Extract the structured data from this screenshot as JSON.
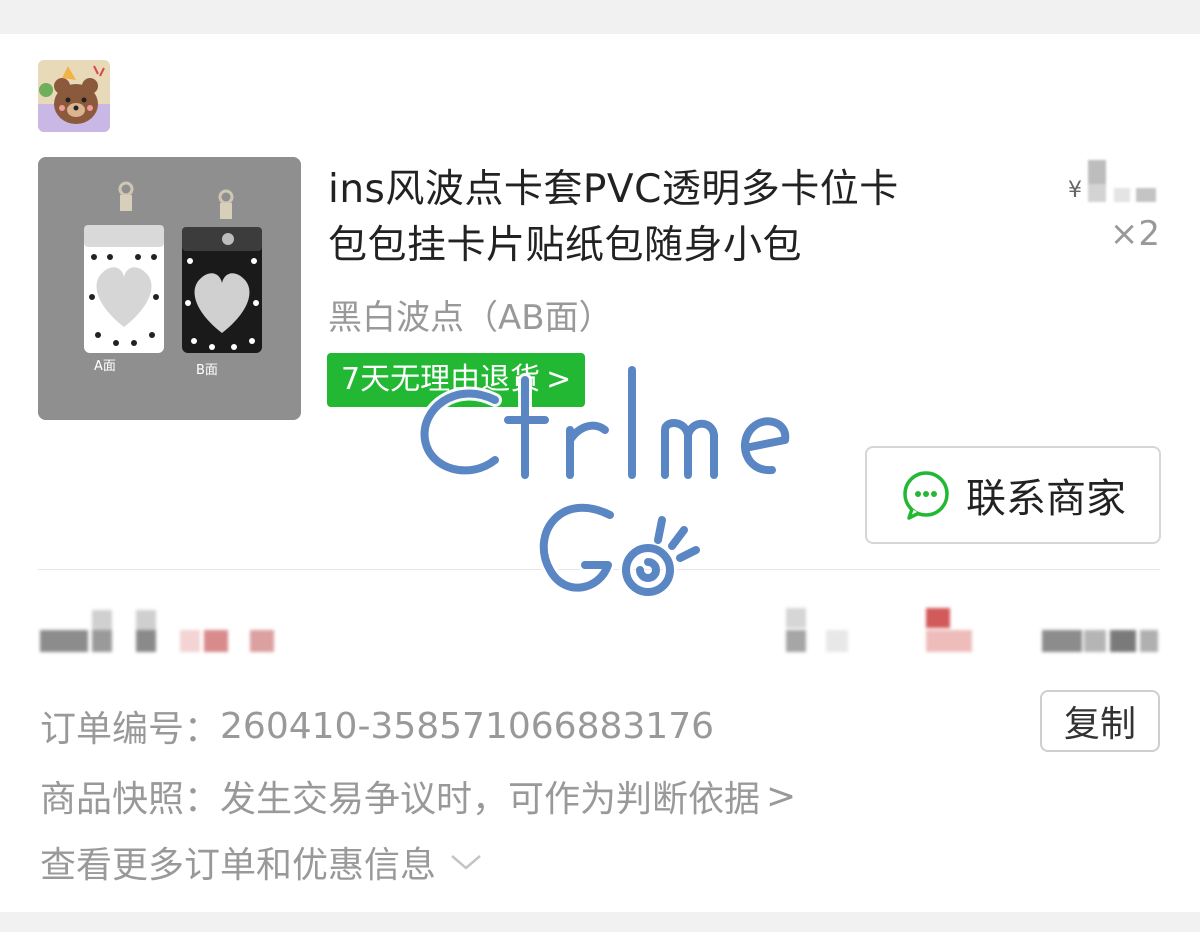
{
  "product": {
    "title": "ins风波点卡套PVC透明多卡位卡包包挂卡片贴纸包随身小包",
    "title_line1": "ins风波点卡套PVC透明多卡位卡",
    "title_line2": "包包挂卡片贴纸包随身小包",
    "spec": "黑白波点（AB面）",
    "badge": "7天无理由退货",
    "badge_chevron": ">",
    "price_currency": "¥",
    "quantity": "×2",
    "image_labels": [
      "A面",
      "B面"
    ]
  },
  "contact_button": {
    "label": "联系商家",
    "icon": "wechat-chat-icon"
  },
  "order": {
    "number_key": "订单编号：",
    "number_value": "260410-358571066883176",
    "copy_label": "复制",
    "snapshot_key": "商品快照：",
    "snapshot_value": "发生交易争议时，可作为判断依据",
    "snapshot_chevron": ">",
    "more_label": "查看更多订单和优惠信息",
    "more_chevron": "chevron-down-icon"
  },
  "watermark": {
    "text": "Ctrlme Go"
  },
  "colors": {
    "badge_green": "#22b833",
    "wechat_green": "#22b833",
    "watermark_blue": "#5b86c4"
  }
}
